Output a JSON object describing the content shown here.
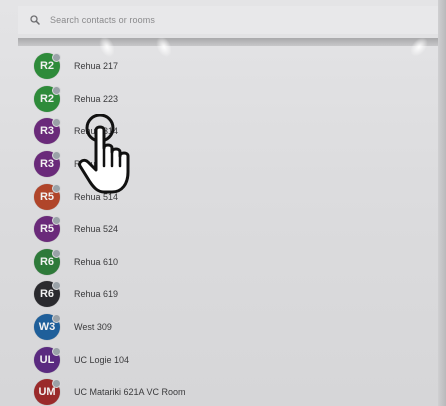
{
  "search": {
    "placeholder": "Search contacts or rooms"
  },
  "contacts": [
    {
      "initials": "R2",
      "name": "Rehua 217",
      "color": "#2e8b3a"
    },
    {
      "initials": "R2",
      "name": "Rehua 223",
      "color": "#2e8b3a"
    },
    {
      "initials": "R3",
      "name": "Rehua 314",
      "color": "#6a2a7a"
    },
    {
      "initials": "R3",
      "name": "Rehua 324",
      "color": "#6a2a7a"
    },
    {
      "initials": "R5",
      "name": "Rehua 514",
      "color": "#b0452a"
    },
    {
      "initials": "R5",
      "name": "Rehua 524",
      "color": "#6a2a7a"
    },
    {
      "initials": "R6",
      "name": "Rehua 610",
      "color": "#2e7a3a"
    },
    {
      "initials": "R6",
      "name": "Rehua 619",
      "color": "#2a2a2e"
    },
    {
      "initials": "W3",
      "name": "West 309",
      "color": "#1f5f9a"
    },
    {
      "initials": "UL",
      "name": "UC Logie 104",
      "color": "#5a2a80"
    },
    {
      "initials": "UM",
      "name": "UC Matariki 621A VC Room",
      "color": "#9a2a2a"
    }
  ],
  "icons": {
    "search": "search-icon",
    "pointer": "hand-pointer-icon"
  }
}
